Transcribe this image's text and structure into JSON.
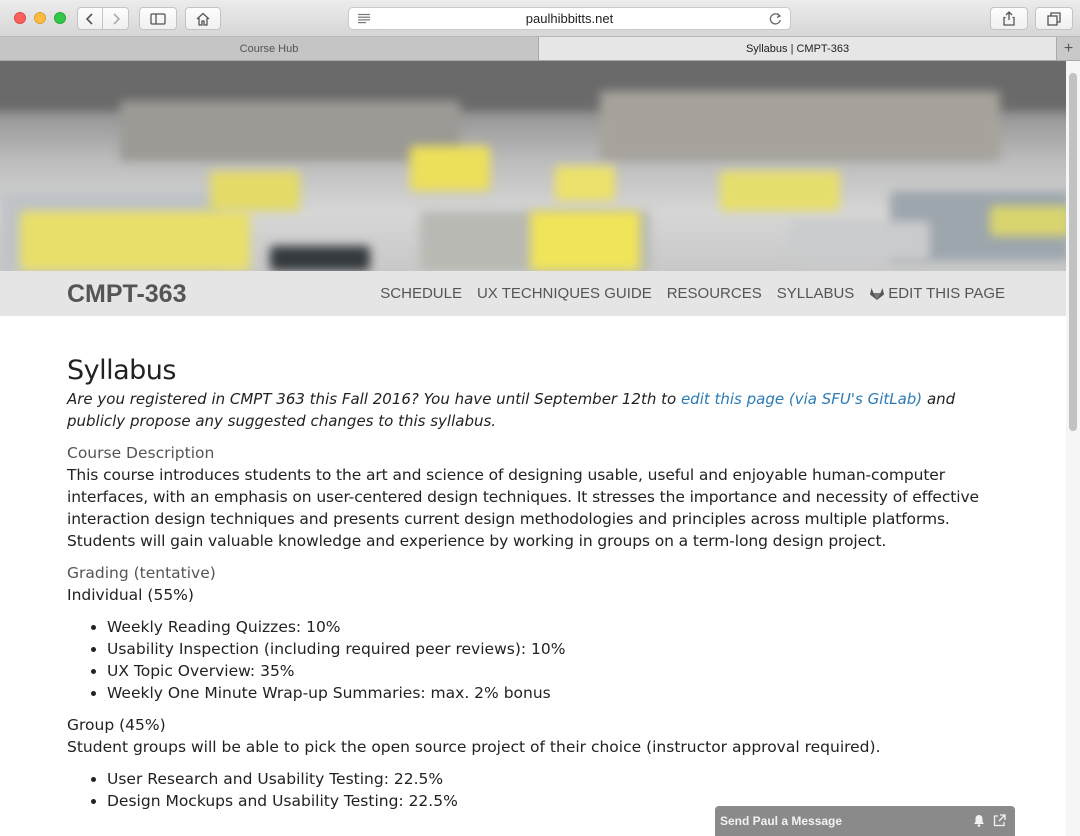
{
  "browser": {
    "url": "paulhibbitts.net",
    "tabs": [
      {
        "label": "Course Hub",
        "active": false
      },
      {
        "label": "Syllabus | CMPT-363",
        "active": true
      }
    ],
    "new_tab_label": "+"
  },
  "site": {
    "brand": "CMPT-363",
    "nav": [
      "SCHEDULE",
      "UX TECHNIQUES GUIDE",
      "RESOURCES",
      "SYLLABUS",
      "EDIT THIS PAGE"
    ]
  },
  "page": {
    "title": "Syllabus",
    "intro_before": "Are you registered in CMPT 363 this Fall 2016? You have until September 12th to ",
    "intro_link": "edit this page (via SFU's GitLab)",
    "intro_after": " and publicly propose any suggested changes to this syllabus.",
    "course_description_heading": "Course Description",
    "course_description": "This course introduces students to the art and science of designing usable, useful and enjoyable human-computer interfaces, with an emphasis on user-centered design techniques. It stresses the importance and necessity of effective interaction design techniques and presents current design methodologies and principles across multiple platforms. Students will gain valuable knowledge and experience by working in groups on a term-long design project.",
    "grading_heading": "Grading (tentative)",
    "individual_label": "Individual (55%)",
    "individual_items": [
      "Weekly Reading Quizzes: 10%",
      "Usability Inspection (including required peer reviews): 10%",
      "UX Topic Overview: 35%",
      "Weekly One Minute Wrap-up Summaries: max. 2% bonus"
    ],
    "group_label": "Group (45%)",
    "group_text": "Student groups will be able to pick the open source project of their choice (instructor approval required).",
    "group_items": [
      "User Research and Usability Testing: 22.5%",
      "Design Mockups and Usability Testing: 22.5%"
    ]
  },
  "chat": {
    "label": "Send Paul a Message"
  },
  "colors": {
    "link": "#2c7bb6",
    "nav_bg": "#e5e5e5",
    "chat_bg": "#8a8a8a"
  }
}
